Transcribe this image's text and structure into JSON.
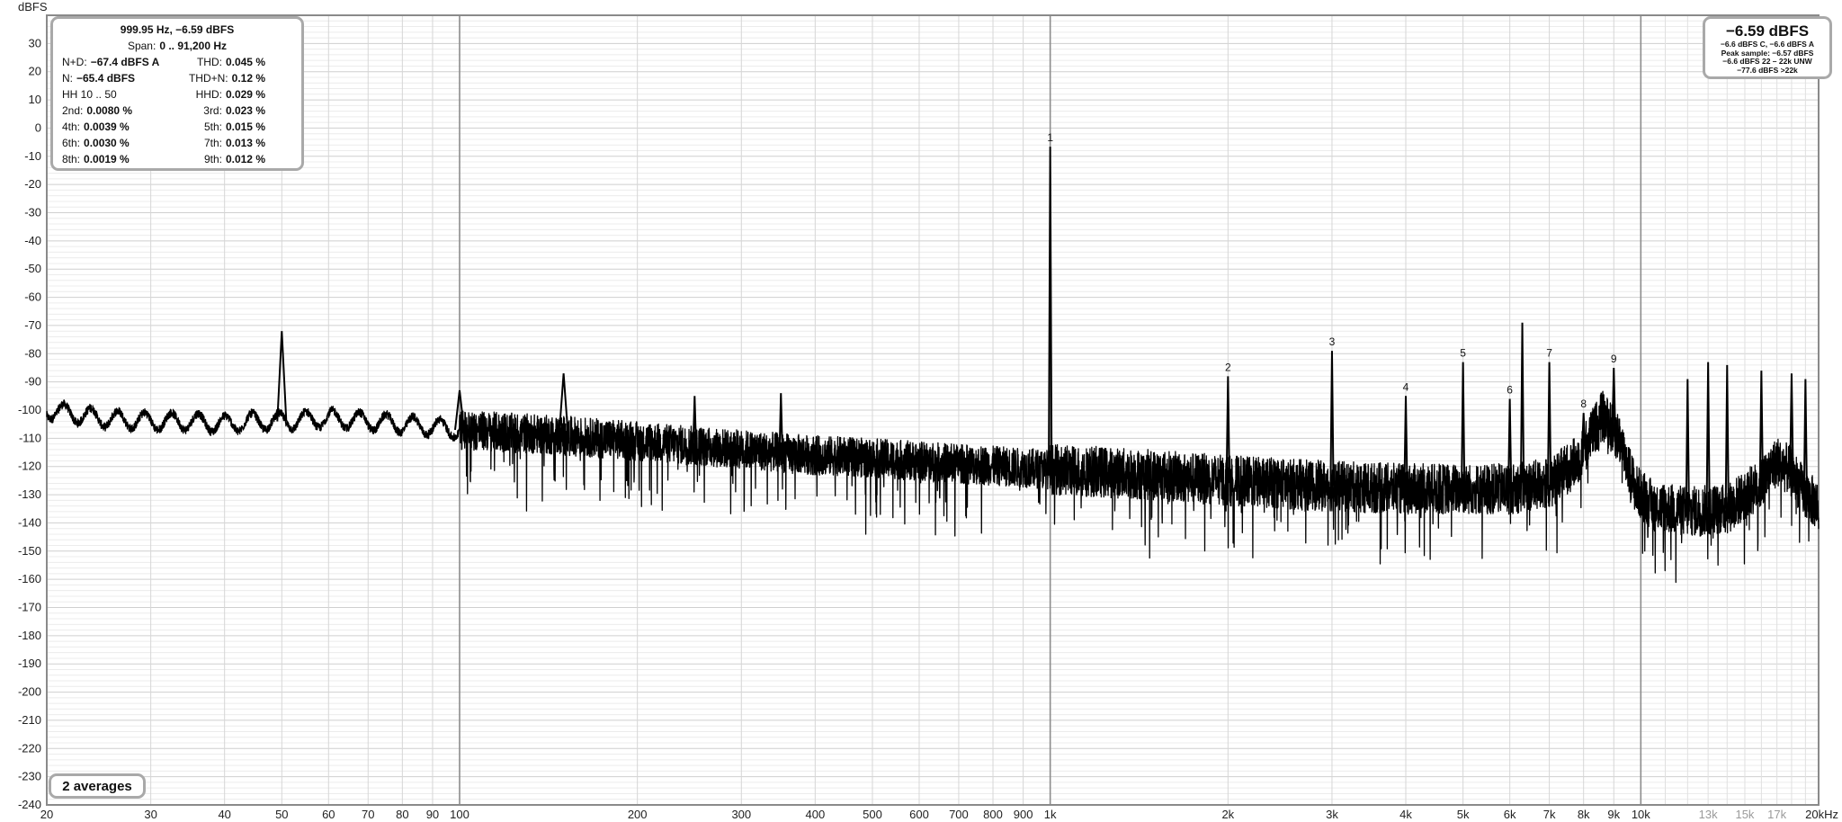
{
  "chart_data": {
    "type": "line",
    "title": "",
    "ylabel": "dBFS",
    "xlabel": "",
    "x_scale": "log",
    "xlim": [
      20,
      20000
    ],
    "ylim": [
      -240,
      40
    ],
    "grid": true,
    "y_ticks": [
      30,
      20,
      10,
      0,
      -10,
      -20,
      -30,
      -40,
      -50,
      -60,
      -70,
      -80,
      -90,
      -100,
      -110,
      -120,
      -130,
      -140,
      -150,
      -160,
      -170,
      -180,
      -190,
      -200,
      -210,
      -220,
      -230,
      -240
    ],
    "x_ticks": [
      {
        "value": 20,
        "label": "20"
      },
      {
        "value": 30,
        "label": "30"
      },
      {
        "value": 40,
        "label": "40"
      },
      {
        "value": 50,
        "label": "50"
      },
      {
        "value": 60,
        "label": "60"
      },
      {
        "value": 70,
        "label": "70"
      },
      {
        "value": 80,
        "label": "80"
      },
      {
        "value": 90,
        "label": "90"
      },
      {
        "value": 100,
        "label": "100"
      },
      {
        "value": 200,
        "label": "200"
      },
      {
        "value": 300,
        "label": "300"
      },
      {
        "value": 400,
        "label": "400"
      },
      {
        "value": 500,
        "label": "500"
      },
      {
        "value": 600,
        "label": "600"
      },
      {
        "value": 700,
        "label": "700"
      },
      {
        "value": 800,
        "label": "800"
      },
      {
        "value": 900,
        "label": "900"
      },
      {
        "value": 1000,
        "label": "1k"
      },
      {
        "value": 2000,
        "label": "2k"
      },
      {
        "value": 3000,
        "label": "3k"
      },
      {
        "value": 4000,
        "label": "4k"
      },
      {
        "value": 5000,
        "label": "5k"
      },
      {
        "value": 6000,
        "label": "6k"
      },
      {
        "value": 7000,
        "label": "7k"
      },
      {
        "value": 8000,
        "label": "8k"
      },
      {
        "value": 9000,
        "label": "9k"
      },
      {
        "value": 10000,
        "label": "10k"
      },
      {
        "value": 13000,
        "label": "13k",
        "dim": true
      },
      {
        "value": 15000,
        "label": "15k",
        "dim": true
      },
      {
        "value": 17000,
        "label": "17k",
        "dim": true
      },
      {
        "value": 20000,
        "label": "20kHz"
      }
    ],
    "noise_floor": [
      [
        20,
        -100
      ],
      [
        25,
        -103
      ],
      [
        30,
        -104
      ],
      [
        35,
        -104
      ],
      [
        40,
        -105
      ],
      [
        45,
        -104
      ],
      [
        50,
        -104
      ],
      [
        60,
        -103
      ],
      [
        70,
        -104
      ],
      [
        80,
        -105
      ],
      [
        90,
        -106
      ],
      [
        100,
        -107
      ],
      [
        150,
        -109
      ],
      [
        200,
        -111
      ],
      [
        300,
        -114
      ],
      [
        400,
        -116
      ],
      [
        500,
        -117
      ],
      [
        700,
        -119
      ],
      [
        1000,
        -121
      ],
      [
        1500,
        -123
      ],
      [
        2000,
        -125
      ],
      [
        3000,
        -127
      ],
      [
        4000,
        -128
      ],
      [
        5000,
        -128
      ],
      [
        6000,
        -128
      ],
      [
        7000,
        -126
      ],
      [
        7800,
        -118
      ],
      [
        8600,
        -102
      ],
      [
        9200,
        -110
      ],
      [
        9800,
        -128
      ],
      [
        10500,
        -134
      ],
      [
        12000,
        -136
      ],
      [
        14000,
        -135
      ],
      [
        16000,
        -126
      ],
      [
        17000,
        -118
      ],
      [
        18000,
        -122
      ],
      [
        19000,
        -130
      ],
      [
        20000,
        -134
      ]
    ],
    "spikes": [
      {
        "x": 50,
        "y": -72
      },
      {
        "x": 100,
        "y": -93
      },
      {
        "x": 150,
        "y": -87
      },
      {
        "x": 250,
        "y": -95
      },
      {
        "x": 350,
        "y": -94
      },
      {
        "x": 1000,
        "y": -6.6
      },
      {
        "x": 2000,
        "y": -88
      },
      {
        "x": 3000,
        "y": -79
      },
      {
        "x": 4000,
        "y": -95
      },
      {
        "x": 5000,
        "y": -83
      },
      {
        "x": 6000,
        "y": -96
      },
      {
        "x": 6300,
        "y": -69
      },
      {
        "x": 7000,
        "y": -83
      },
      {
        "x": 8000,
        "y": -101
      },
      {
        "x": 9000,
        "y": -85
      },
      {
        "x": 12000,
        "y": -89
      },
      {
        "x": 13000,
        "y": -83
      },
      {
        "x": 14000,
        "y": -84
      },
      {
        "x": 16000,
        "y": -86
      },
      {
        "x": 18000,
        "y": -87
      },
      {
        "x": 19000,
        "y": -89
      }
    ],
    "harmonic_labels": [
      {
        "label": "1",
        "x": 1000,
        "y": -6.6
      },
      {
        "label": "2",
        "x": 2000,
        "y": -88
      },
      {
        "label": "3",
        "x": 3000,
        "y": -79
      },
      {
        "label": "4",
        "x": 4000,
        "y": -95
      },
      {
        "label": "5",
        "x": 5000,
        "y": -83
      },
      {
        "label": "6",
        "x": 6000,
        "y": -96
      },
      {
        "label": "7",
        "x": 7000,
        "y": -83
      },
      {
        "label": "8",
        "x": 8000,
        "y": -101
      },
      {
        "label": "9",
        "x": 9000,
        "y": -85
      }
    ],
    "line_color": "#000000"
  },
  "stats": {
    "header": "999.95 Hz, −6.59 dBFS",
    "span_label": "Span:",
    "span_value": "0 .. 91,200 Hz",
    "rows": [
      {
        "l_label": "N+D:",
        "l_value": "−67.4 dBFS A",
        "r_label": "THD:",
        "r_value": "0.045 %"
      },
      {
        "l_label": "N:",
        "l_value": "−65.4 dBFS",
        "r_label": "THD+N:",
        "r_value": "0.12 %"
      },
      {
        "l_label": "HH 10 .. 50",
        "l_value": "",
        "r_label": "HHD:",
        "r_value": "0.029 %"
      },
      {
        "l_label": "2nd:",
        "l_value": "0.0080 %",
        "r_label": "3rd:",
        "r_value": "0.023 %"
      },
      {
        "l_label": "4th:",
        "l_value": "0.0039 %",
        "r_label": "5th:",
        "r_value": "0.015 %"
      },
      {
        "l_label": "6th:",
        "l_value": "0.0030 %",
        "r_label": "7th:",
        "r_value": "0.013 %"
      },
      {
        "l_label": "8th:",
        "l_value": "0.0019 %",
        "r_label": "9th:",
        "r_value": "0.012 %"
      }
    ]
  },
  "level": {
    "main": "−6.59 dBFS",
    "lines": [
      "−6.6 dBFS C, −6.6 dBFS A",
      "Peak sample: −6.57 dBFS",
      "−6.6 dBFS 22 – 22k UNW",
      "−77.6 dBFS >22k"
    ]
  },
  "averages": "2 averages"
}
